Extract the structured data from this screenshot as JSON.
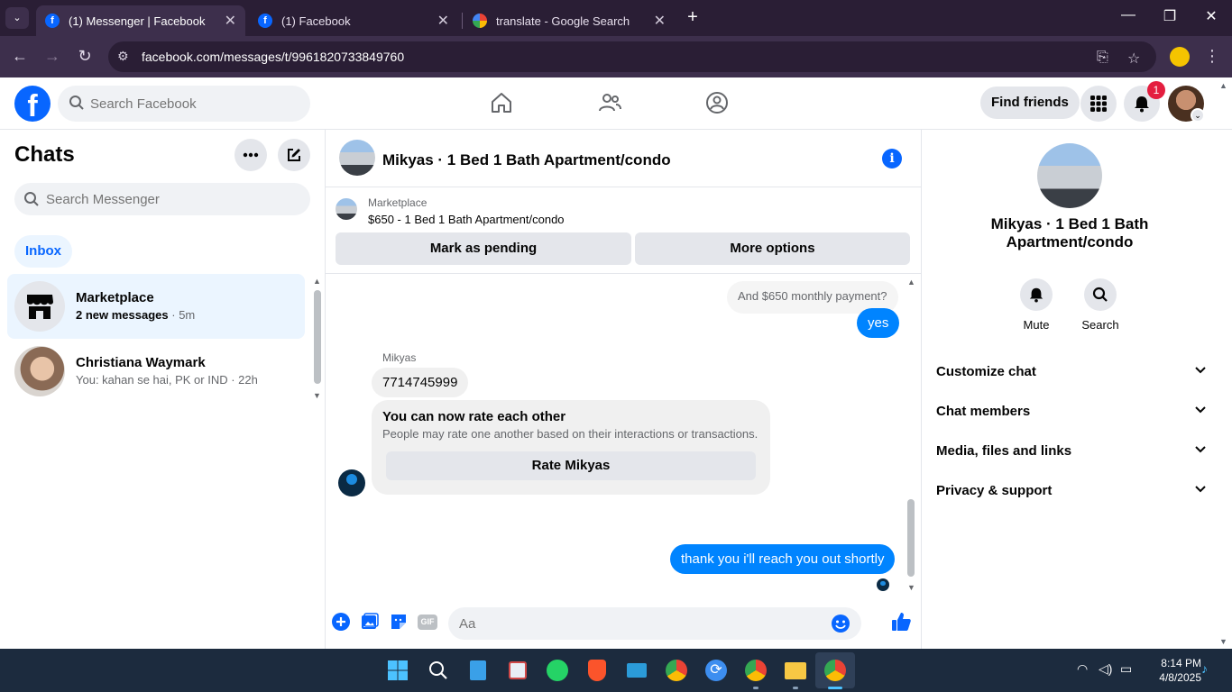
{
  "browser": {
    "tabs": [
      {
        "title": "(1) Messenger | Facebook",
        "active": true
      },
      {
        "title": "(1) Facebook",
        "active": false
      },
      {
        "title": "translate - Google Search",
        "active": false
      }
    ],
    "url": "facebook.com/messages/t/9961820733849760"
  },
  "fb_header": {
    "search_placeholder": "Search Facebook",
    "find_friends_label": "Find friends",
    "notification_count": "1"
  },
  "sidebar": {
    "title": "Chats",
    "search_placeholder": "Search Messenger",
    "filter_label": "Inbox",
    "chats": [
      {
        "name": "Marketplace",
        "preview_bold": "2 new messages",
        "time": "· 5m",
        "selected": true
      },
      {
        "name": "Christiana Waymark",
        "preview": "You: kahan se hai, PK or IND · 22h",
        "selected": false
      }
    ]
  },
  "conversation": {
    "title": "Mikyas · 1 Bed 1 Bath Apartment/condo",
    "marketplace_label": "Marketplace",
    "listing": "$650 - 1 Bed 1 Bath Apartment/condo",
    "mark_pending_label": "Mark as pending",
    "more_options_label": "More options",
    "messages": {
      "faded_prev": "And $650 monthly payment?",
      "reply_yes": "yes",
      "sender_name": "Mikyas",
      "phone": "7714745999",
      "rate_title": "You can now rate each other",
      "rate_subtitle": "People may rate one another based on their interactions or transactions.",
      "rate_button": "Rate Mikyas",
      "outgoing_last": "thank you i'll reach you out shortly"
    },
    "composer_placeholder": "Aa"
  },
  "info_panel": {
    "name": "Mikyas · 1 Bed 1 Bath Apartment/condo",
    "mute_label": "Mute",
    "search_label": "Search",
    "sections": [
      "Customize chat",
      "Chat members",
      "Media, files and links",
      "Privacy & support"
    ]
  },
  "taskbar": {
    "time": "8:14 PM",
    "date": "4/8/2025"
  },
  "colors": {
    "fb_blue": "#0866ff",
    "messenger_blue": "#0084ff",
    "chrome_frame": "#2a1e35",
    "taskbar": "#1c2b3e"
  }
}
